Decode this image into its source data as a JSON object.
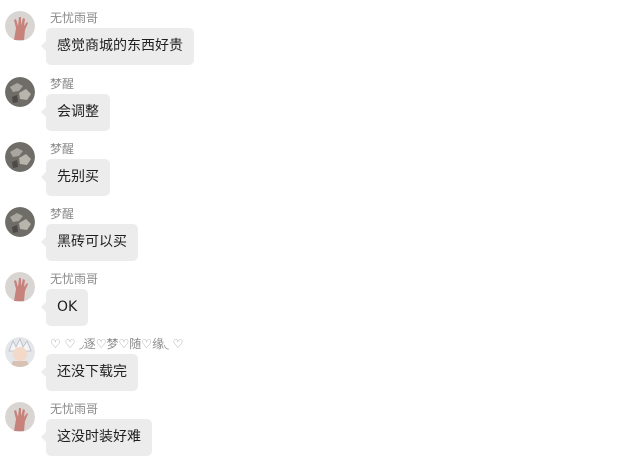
{
  "messages": [
    {
      "avatar": "hand-avatar",
      "sender": "无忧雨哥",
      "text": "感觉商城的东西好贵"
    },
    {
      "avatar": "stone-avatar",
      "sender": "梦醒",
      "text": "会调整"
    },
    {
      "avatar": "stone-avatar",
      "sender": "梦醒",
      "text": "先别买"
    },
    {
      "avatar": "stone-avatar",
      "sender": "梦醒",
      "text": "黑砖可以买"
    },
    {
      "avatar": "hand-avatar",
      "sender": "无忧雨哥",
      "text": "OK"
    },
    {
      "avatar": "anime-avatar",
      "sender": "♡ ♡ ◞逐♡梦♡随♡缘◟ ♡",
      "text": "还没下载完"
    },
    {
      "avatar": "hand-avatar",
      "sender": "无忧雨哥",
      "text": "这没时装好难"
    }
  ],
  "colors": {
    "bubble": "#ececec",
    "sender_text": "#8a8a8a",
    "message_text": "#1f1f1f"
  }
}
